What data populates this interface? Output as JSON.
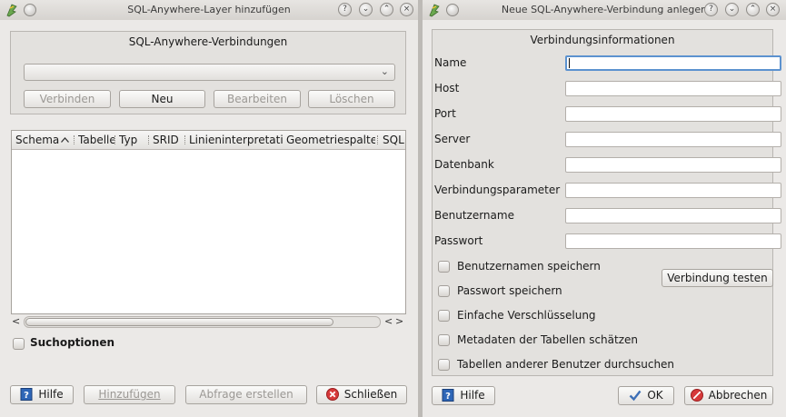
{
  "left_window": {
    "title": "SQL-Anywhere-Layer hinzufügen",
    "connections_group_title": "SQL-Anywhere-Verbindungen",
    "connection_combo_value": "",
    "buttons": {
      "connect": "Verbinden",
      "new": "Neu",
      "edit": "Bearbeiten",
      "delete": "Löschen"
    },
    "table_columns": [
      "Schema",
      "Tabelle",
      "Typ",
      "SRID",
      "Linieninterpretation",
      "Geometriespalte",
      "SQL"
    ],
    "search_options_label": "Suchoptionen",
    "footer_buttons": {
      "help": "Hilfe",
      "add": "Hinzufügen",
      "build_query": "Abfrage erstellen",
      "close": "Schließen"
    }
  },
  "right_window": {
    "title": "Neue SQL-Anywhere-Verbindung anlegen",
    "group_title": "Verbindungsinformationen",
    "fields": [
      {
        "label": "Name",
        "value": ""
      },
      {
        "label": "Host",
        "value": ""
      },
      {
        "label": "Port",
        "value": ""
      },
      {
        "label": "Server",
        "value": ""
      },
      {
        "label": "Datenbank",
        "value": ""
      },
      {
        "label": "Verbindungsparameter",
        "value": ""
      },
      {
        "label": "Benutzername",
        "value": ""
      },
      {
        "label": "Passwort",
        "value": ""
      }
    ],
    "checkboxes": [
      {
        "label": "Benutzernamen speichern",
        "checked": false
      },
      {
        "label": "Passwort speichern",
        "checked": false
      },
      {
        "label": "Einfache Verschlüsselung",
        "checked": false
      },
      {
        "label": "Metadaten der Tabellen schätzen",
        "checked": false
      },
      {
        "label": "Tabellen anderer Benutzer durchsuchen",
        "checked": false
      }
    ],
    "test_button": "Verbindung testen",
    "footer_buttons": {
      "help": "Hilfe",
      "ok": "OK",
      "cancel": "Abbrechen"
    }
  },
  "titlebar_buttons": {
    "help": "?",
    "minimize": "⌄",
    "maximize": "⌃",
    "close": "×"
  },
  "colors": {
    "background": "#ebe9e7",
    "focus": "#5c92cf",
    "close_icon": "#d6393a",
    "help_icon": "#2e66b7",
    "ok_check": "#3d6fb6"
  }
}
